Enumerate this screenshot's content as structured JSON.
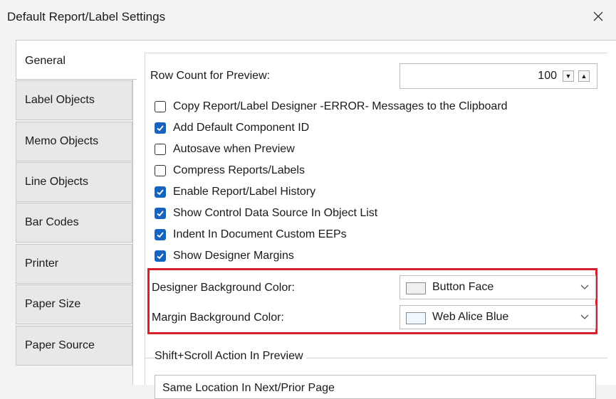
{
  "window": {
    "title": "Default Report/Label Settings"
  },
  "tabs": [
    {
      "label": "General",
      "active": true
    },
    {
      "label": "Label Objects"
    },
    {
      "label": "Memo Objects"
    },
    {
      "label": "Line Objects"
    },
    {
      "label": "Bar Codes"
    },
    {
      "label": "Printer"
    },
    {
      "label": "Paper Size"
    },
    {
      "label": "Paper Source"
    }
  ],
  "general": {
    "row_count_label": "Row Count for Preview:",
    "row_count_value": "100",
    "options": [
      {
        "label": "Copy Report/Label Designer -ERROR- Messages to the Clipboard",
        "checked": false
      },
      {
        "label": "Add Default Component ID",
        "checked": true
      },
      {
        "label": "Autosave when Preview",
        "checked": false
      },
      {
        "label": "Compress Reports/Labels",
        "checked": false
      },
      {
        "label": "Enable Report/Label History",
        "checked": true
      },
      {
        "label": "Show Control Data Source In Object List",
        "checked": true
      },
      {
        "label": "Indent In Document Custom EEPs",
        "checked": true
      },
      {
        "label": "Show Designer Margins",
        "checked": true
      }
    ],
    "designer_bg": {
      "label": "Designer Background Color:",
      "value": "Button Face",
      "swatch": "#f0f0f0"
    },
    "margin_bg": {
      "label": "Margin Background Color:",
      "value": "Web Alice Blue",
      "swatch": "#f0f8ff"
    },
    "shift_scroll": {
      "label": "Shift+Scroll Action In Preview",
      "value": "Same Location In Next/Prior Page"
    }
  },
  "colors": {
    "accent": "#1565c0",
    "highlight": "#d6202e"
  }
}
